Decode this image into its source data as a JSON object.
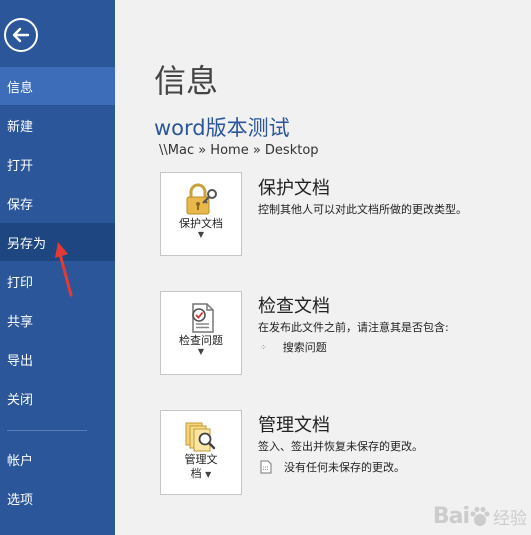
{
  "sidebar": {
    "items": [
      {
        "label": "信息"
      },
      {
        "label": "新建"
      },
      {
        "label": "打开"
      },
      {
        "label": "保存"
      },
      {
        "label": "另存为"
      },
      {
        "label": "打印"
      },
      {
        "label": "共享"
      },
      {
        "label": "导出"
      },
      {
        "label": "关闭"
      },
      {
        "label": "帐户"
      },
      {
        "label": "选项"
      }
    ],
    "selected": "信息",
    "hovered": "另存为"
  },
  "main": {
    "page_title": "信息",
    "doc_title": "word版本测试",
    "doc_path": "\\\\Mac » Home » Desktop",
    "sections": [
      {
        "button_label": "保护文档",
        "title": "保护文档",
        "description": "控制其他人可以对此文档所做的更改类型。",
        "icon": "lock-icon"
      },
      {
        "button_label": "检查问题",
        "title": "检查文档",
        "description": "在发布此文件之前，请注意其是否包含:",
        "sub_item": "搜索问题",
        "icon": "inspect-icon"
      },
      {
        "button_label_1": "管理文",
        "button_label_2": "档",
        "title": "管理文档",
        "description": "签入、签出并恢复未保存的更改。",
        "sub_item": "没有任何未保存的更改。",
        "icon": "manage-versions-icon"
      }
    ]
  },
  "watermark": {
    "text": "经验"
  },
  "colors": {
    "sidebar": "#2b579a",
    "selected": "#3d6db8",
    "accent": "#2b579a",
    "annotation": "#e53935"
  }
}
